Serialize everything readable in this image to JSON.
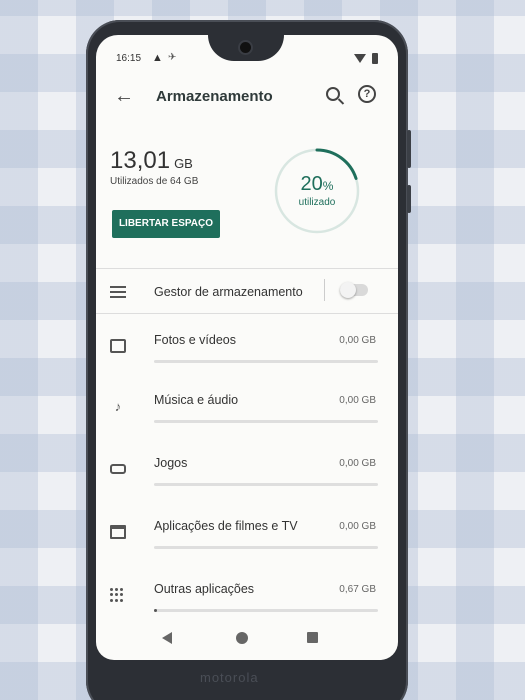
{
  "status_bar": {
    "time": "16:15"
  },
  "app_bar": {
    "title": "Armazenamento"
  },
  "summary": {
    "used_value": "13,01",
    "used_unit": "GB",
    "used_of": "Utilizados de 64 GB",
    "percent": "20",
    "percent_sign": "%",
    "percent_label": "utilizado",
    "percent_fraction": 0.2,
    "free_button": "LIBERTAR ESPAÇO"
  },
  "storage_manager": {
    "label": "Gestor de armazenamento",
    "enabled": false
  },
  "categories": [
    {
      "label": "Fotos e vídeos",
      "size": "0,00 GB",
      "fraction": 0.0,
      "icon": "photo-icon"
    },
    {
      "label": "Música e áudio",
      "size": "0,00 GB",
      "fraction": 0.0,
      "icon": "music-note-icon"
    },
    {
      "label": "Jogos",
      "size": "0,00 GB",
      "fraction": 0.0,
      "icon": "gamepad-icon"
    },
    {
      "label": "Aplicações de filmes e TV",
      "size": "0,00 GB",
      "fraction": 0.0,
      "icon": "film-icon"
    },
    {
      "label": "Outras aplicações",
      "size": "0,67 GB",
      "fraction": 0.01,
      "icon": "apps-grid-icon"
    }
  ],
  "colors": {
    "accent": "#1f6f5c",
    "track": "#dedede",
    "bar": "#555555"
  },
  "device": {
    "brand": "motorola"
  }
}
